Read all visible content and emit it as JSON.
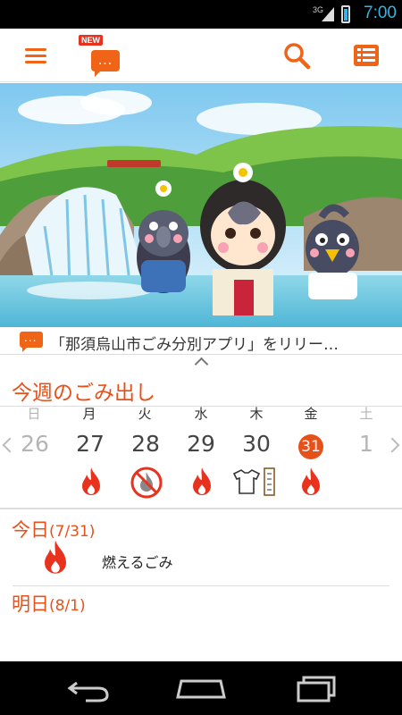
{
  "status_bar": {
    "network": "3G",
    "time": "7:00"
  },
  "toolbar": {
    "menu_icon": "hamburger-menu-icon",
    "news_badge": "NEW",
    "news_icon": "speech-bubble-icon",
    "search_icon": "search-icon",
    "list_icon": "list-view-icon",
    "accent_color": "#f06418"
  },
  "news": {
    "text": "「那須烏山市ごみ分別アプリ」をリリー…"
  },
  "week": {
    "title": "今週のごみ出し",
    "day_names": [
      "日",
      "月",
      "火",
      "水",
      "木",
      "金",
      "土"
    ],
    "dates": [
      "26",
      "27",
      "28",
      "29",
      "30",
      "31",
      "1"
    ],
    "today_index": 5,
    "icons": [
      "",
      "burnable-flame-icon",
      "no-burn-icon",
      "burnable-flame-icon",
      "clothes-and-paper-icon",
      "burnable-flame-icon",
      ""
    ]
  },
  "today": {
    "label": "今日",
    "date": "(7/31)",
    "item": "燃えるごみ",
    "icon": "burnable-flame-icon"
  },
  "tomorrow": {
    "label": "明日",
    "date": "(8/1)"
  },
  "nav_bar": {
    "back_icon": "back-icon",
    "home_icon": "home-icon",
    "recents_icon": "recent-apps-icon"
  }
}
